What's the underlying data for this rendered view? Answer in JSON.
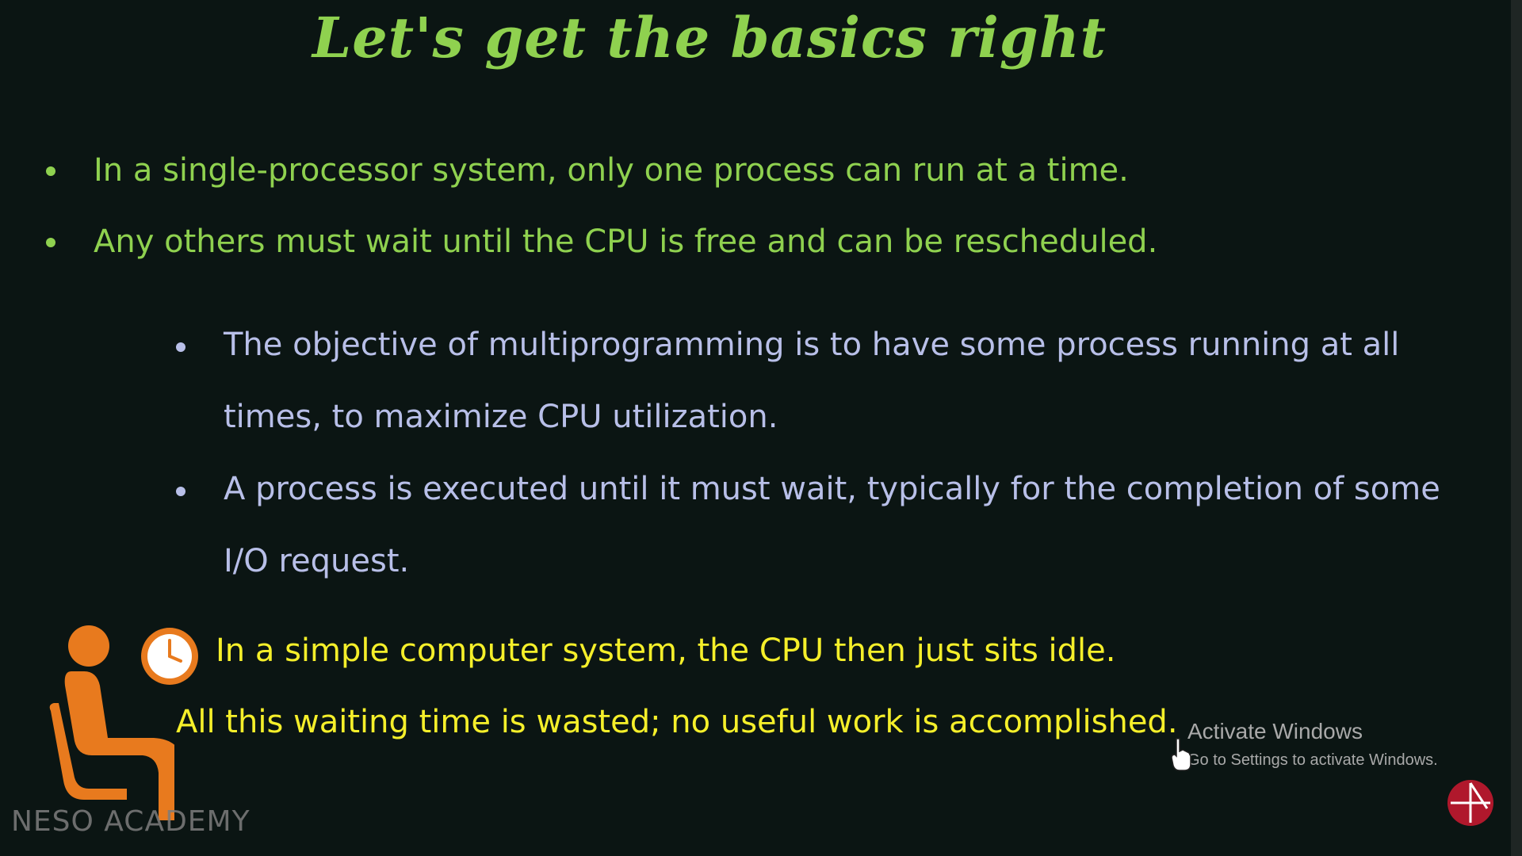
{
  "slide": {
    "title": "Let's get the basics right",
    "bullets": [
      "In a single-processor system, only one process can run at a time.",
      "Any others must wait until the CPU is free and can be rescheduled."
    ],
    "sub_bullets": [
      "The objective of multiprogramming is to have some process running at all times, to maximize CPU utilization.",
      "A process is executed until it must wait, typically for the completion of some I/O request."
    ],
    "highlight_lines": [
      "In a simple computer system, the CPU then just sits idle.",
      "All this waiting time is wasted; no useful work is accomplished."
    ],
    "watermark": "NESO ACADEMY"
  },
  "windows_overlay": {
    "title": "Activate Windows",
    "subtitle": "Go to Settings to activate Windows."
  },
  "colors": {
    "background": "#0b1513",
    "title": "#8fd14f",
    "main_bullets": "#8fd14f",
    "sub_bullets": "#b8bfe8",
    "highlight": "#f5ef2a",
    "person_icon": "#e87a1e"
  },
  "icons": [
    "seated-person-icon",
    "clock-icon",
    "mouse-pointer-icon",
    "channel-logo-icon"
  ]
}
